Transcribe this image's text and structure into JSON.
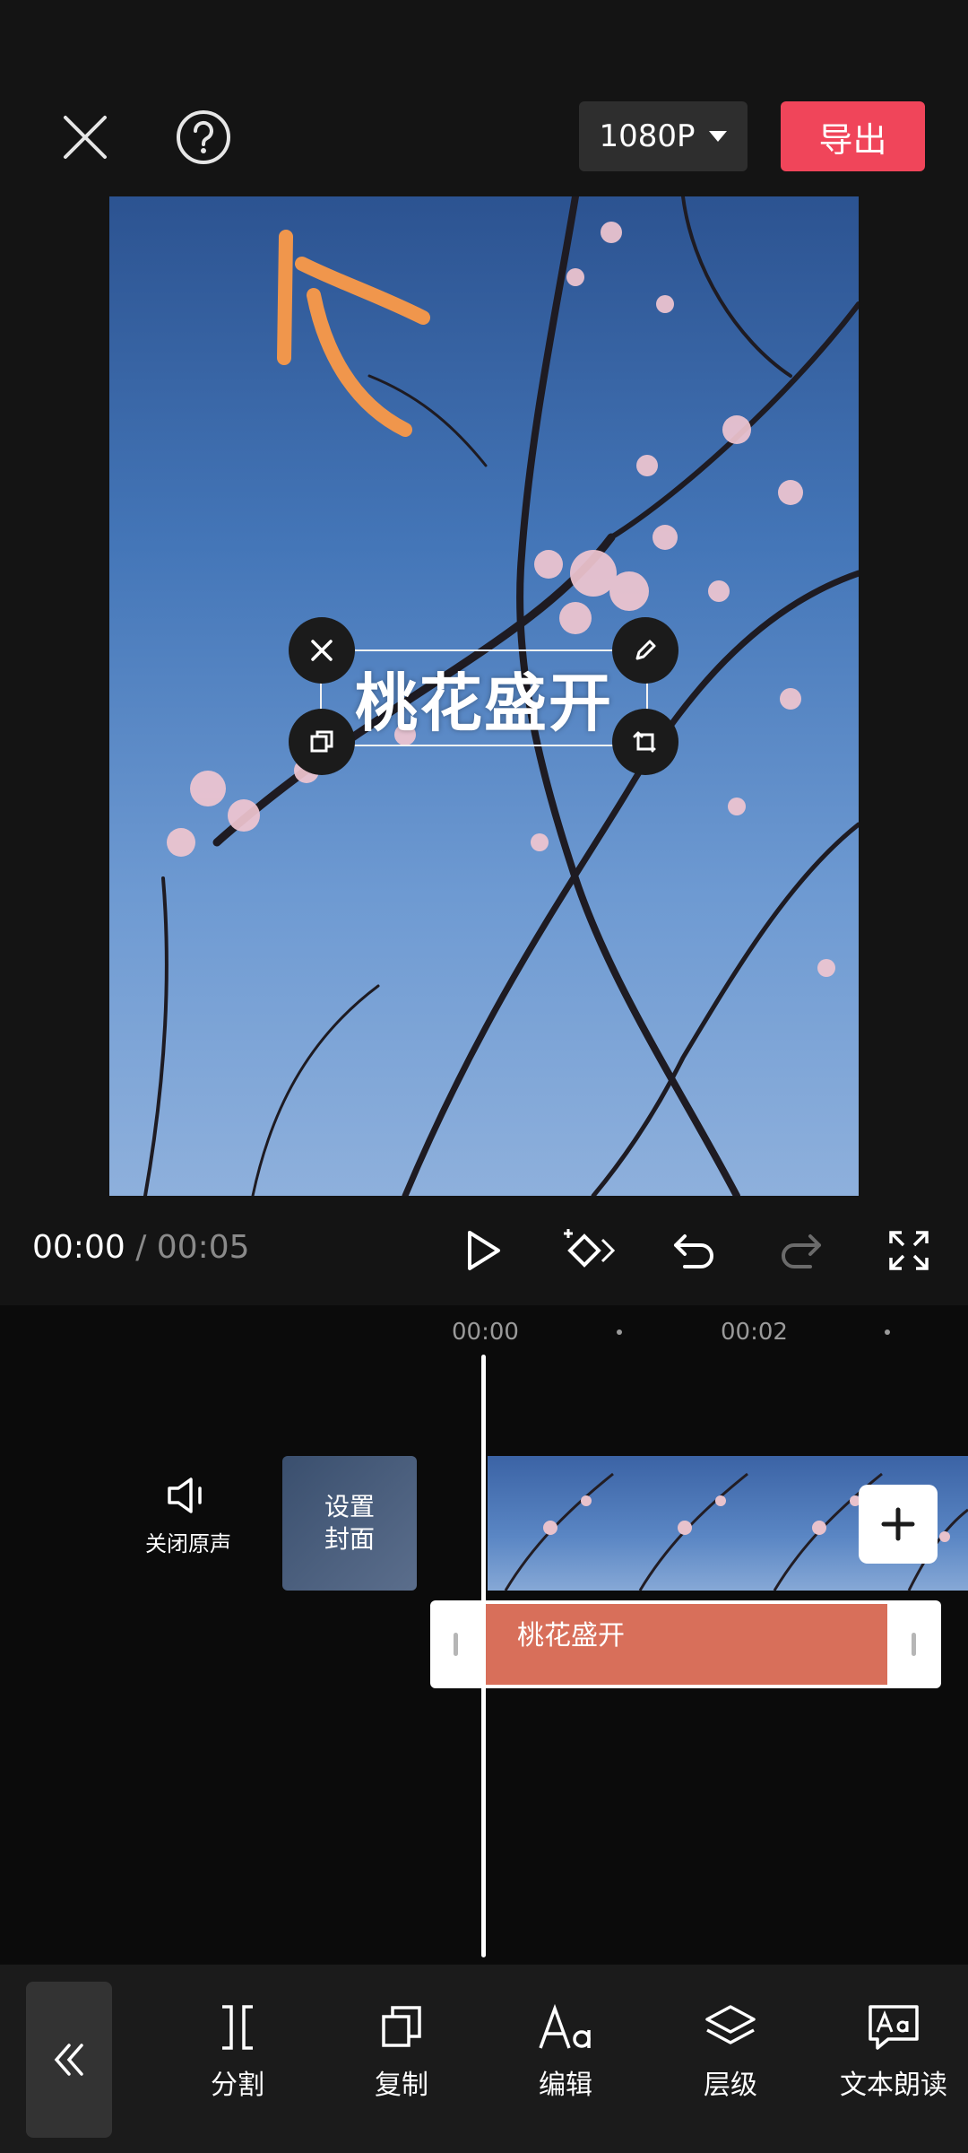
{
  "header": {
    "close_icon": "close-icon",
    "help_icon": "help-icon",
    "resolution": "1080P",
    "export_label": "导出",
    "export_color": "#f0455a"
  },
  "preview": {
    "overlay_text": "桃花盛开",
    "annotation_color": "#f0964c"
  },
  "playback": {
    "current_time": "00:00",
    "separator": "/",
    "total_time": "00:05"
  },
  "timeline": {
    "ticks": [
      "00:00",
      "00:02"
    ],
    "mute_label": "关闭原声",
    "cover_label_line1": "设置",
    "cover_label_line2": "封面",
    "text_clip_label": "桃花盛开",
    "text_clip_color": "#d86f5a"
  },
  "toolbar": {
    "items": [
      {
        "label": "分割",
        "icon": "split-icon"
      },
      {
        "label": "复制",
        "icon": "copy-icon"
      },
      {
        "label": "编辑",
        "icon": "text-style-icon"
      },
      {
        "label": "层级",
        "icon": "layers-icon"
      },
      {
        "label": "文本朗读",
        "icon": "text-to-speech-icon"
      }
    ]
  }
}
